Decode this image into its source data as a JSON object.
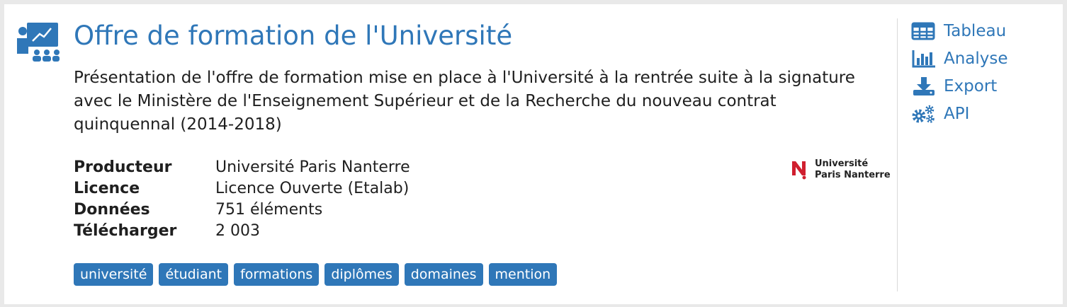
{
  "dataset": {
    "title": "Offre de formation de l'Université",
    "description": "Présentation de l'offre de formation mise en place à l'Université à la rentrée suite à la signature avec le Ministère de l'Enseignement Supérieur et de la Recherche du nouveau contrat quinquennal (2014-2018)",
    "icon": "course-presentation-icon"
  },
  "meta": [
    {
      "key": "Producteur",
      "value": "Université Paris Nanterre"
    },
    {
      "key": "Licence",
      "value": "Licence Ouverte (Etalab)"
    },
    {
      "key": "Données",
      "value": "751 éléments"
    },
    {
      "key": "Télécharger",
      "value": "2 003"
    }
  ],
  "logo": {
    "line1": "Université",
    "line2": "Paris Nanterre",
    "icon": "university-logo"
  },
  "tags": [
    "université",
    "étudiant",
    "formations",
    "diplômes",
    "domaines",
    "mention"
  ],
  "actions": [
    {
      "label": "Tableau",
      "icon": "table-icon"
    },
    {
      "label": "Analyse",
      "icon": "bar-chart-icon"
    },
    {
      "label": "Export",
      "icon": "download-icon"
    },
    {
      "label": "API",
      "icon": "gears-icon"
    }
  ],
  "colors": {
    "accent": "#2f77b8",
    "logo_red": "#d01f2f"
  }
}
